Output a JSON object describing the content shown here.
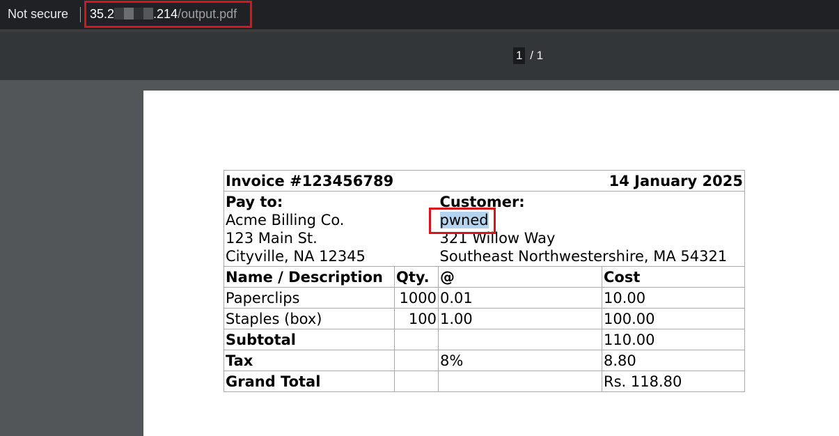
{
  "browser": {
    "security_label": "Not secure",
    "url_host_start": "35.2",
    "url_host_end": ".214",
    "url_path": "/output.pdf"
  },
  "pdf_toolbar": {
    "current_page": "1",
    "page_separator": "/",
    "total_pages": "1"
  },
  "invoice": {
    "number": "Invoice #123456789",
    "date": "14 January 2025",
    "pay_to": {
      "heading": "Pay to:",
      "name": "Acme Billing Co.",
      "street": "123 Main St.",
      "city": "Cityville, NA 12345"
    },
    "customer": {
      "heading": "Customer:",
      "name": "pwned",
      "street": "321 Willow Way",
      "city": "Southeast Northwestershire, MA 54321"
    },
    "columns": [
      "Name / Description",
      "Qty.",
      "@",
      "Cost"
    ],
    "items": [
      {
        "name": "Paperclips",
        "qty": "1000",
        "price": "0.01",
        "cost": "10.00"
      },
      {
        "name": "Staples (box)",
        "qty": "100",
        "price": "1.00",
        "cost": "100.00"
      }
    ],
    "subtotal_label": "Subtotal",
    "subtotal_value": "110.00",
    "tax_label": "Tax",
    "tax_rate": "8%",
    "tax_value": "8.80",
    "grand_total_label": "Grand Total",
    "grand_total_value": "Rs. 118.80"
  },
  "colors": {
    "highlight_box": "#d9141c",
    "selection": "#b3d3ef",
    "viewer_background": "#525659",
    "toolbar_background": "#323639"
  }
}
